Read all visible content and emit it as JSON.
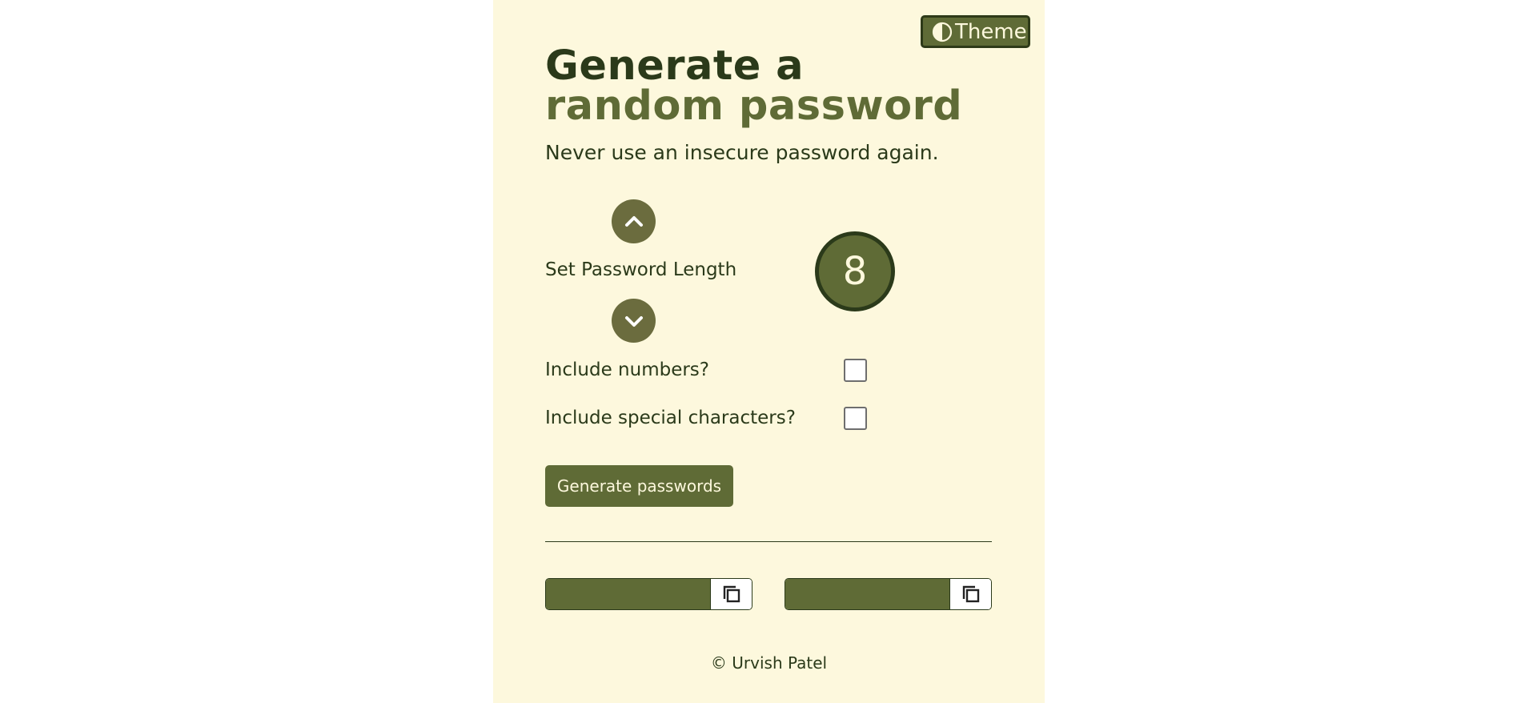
{
  "theme_toggle": {
    "label": "Theme",
    "icon": "half-circle-contrast-icon"
  },
  "hero": {
    "title_line1": "Generate a",
    "title_line2": "random password",
    "subtitle": "Never use an insecure password again."
  },
  "length_control": {
    "label": "Set Password Length",
    "value": "8",
    "increase_icon": "chevron-up-icon",
    "decrease_icon": "chevron-down-icon"
  },
  "options": [
    {
      "label": "Include numbers?",
      "checked": false
    },
    {
      "label": "Include special characters?",
      "checked": false
    }
  ],
  "generate_button": {
    "label": "Generate passwords"
  },
  "passwords": [
    {
      "value": "",
      "copy_icon": "copy-icon"
    },
    {
      "value": "",
      "copy_icon": "copy-icon"
    }
  ],
  "footer": {
    "text": "© Urvish Patel"
  },
  "colors": {
    "background": "#fdf8dd",
    "dark_green": "#2b3a1a",
    "olive": "#5f6b36",
    "arrow_olive": "#6b6c3e"
  }
}
